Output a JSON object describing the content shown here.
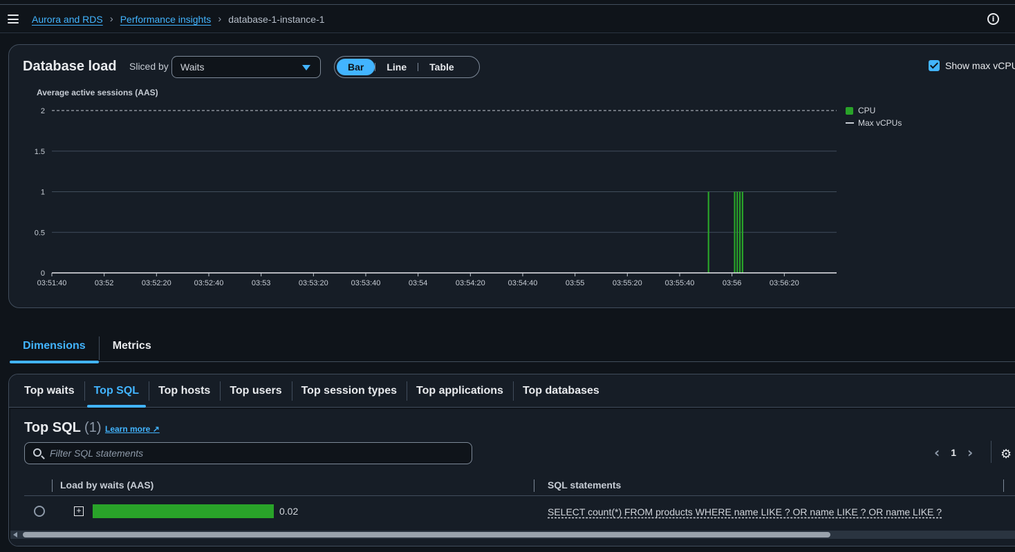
{
  "topbar": {
    "breadcrumbs": [
      "Aurora and RDS",
      "Performance insights"
    ],
    "current": "database-1-instance-1",
    "menu_icon": "hamburger-menu-icon",
    "info_icon": "info-icon"
  },
  "db_load": {
    "title": "Database load",
    "sliced_by_label": "Sliced by",
    "sliced_by_value": "Waits",
    "view_options": [
      "Bar",
      "Line",
      "Table"
    ],
    "selected_view": "Bar",
    "show_max_vcpu_label": "Show max vCPU",
    "show_max_vcpu_checked": true
  },
  "chart_data": {
    "type": "bar",
    "ylabel": "Average active sessions (AAS)",
    "ylim": [
      0,
      2
    ],
    "y_ticks": [
      "0",
      "0.5",
      "1",
      "1.5",
      "2"
    ],
    "x_ticks": [
      "03:51:40",
      "03:52",
      "03:52:20",
      "03:52:40",
      "03:53",
      "03:53:20",
      "03:53:40",
      "03:54",
      "03:54:20",
      "03:54:40",
      "03:55",
      "03:55:20",
      "03:55:40",
      "03:56",
      "03:56:20"
    ],
    "x_range": [
      "03:51:40",
      "03:56:40"
    ],
    "grid": true,
    "legend_position": "right",
    "series": [
      {
        "name": "CPU",
        "color": "#29a329",
        "type": "bar",
        "x": [
          "03:55:51",
          "03:56:01",
          "03:56:02",
          "03:56:03",
          "03:56:04"
        ],
        "values": [
          1,
          1,
          1,
          1,
          1
        ]
      },
      {
        "name": "Max vCPUs",
        "color": "#c6ccd4",
        "type": "line-dashed",
        "value": 2
      }
    ]
  },
  "dimension_tabs": [
    "Dimensions",
    "Metrics"
  ],
  "dimension_active": "Dimensions",
  "sub_tabs": [
    "Top waits",
    "Top SQL",
    "Top hosts",
    "Top users",
    "Top session types",
    "Top applications",
    "Top databases"
  ],
  "sub_active": "Top SQL",
  "top_sql": {
    "title": "Top SQL",
    "count": "(1)",
    "learn_more": "Learn more",
    "search_placeholder": "Filter SQL statements",
    "page": "1",
    "columns": [
      "Load by waits (AAS)",
      "SQL statements"
    ],
    "rows": [
      {
        "load_value": "0.02",
        "load_fraction": 1.0,
        "sql": "SELECT count(*) FROM products WHERE name LIKE ? OR name LIKE ? OR name LIKE ?"
      }
    ]
  }
}
